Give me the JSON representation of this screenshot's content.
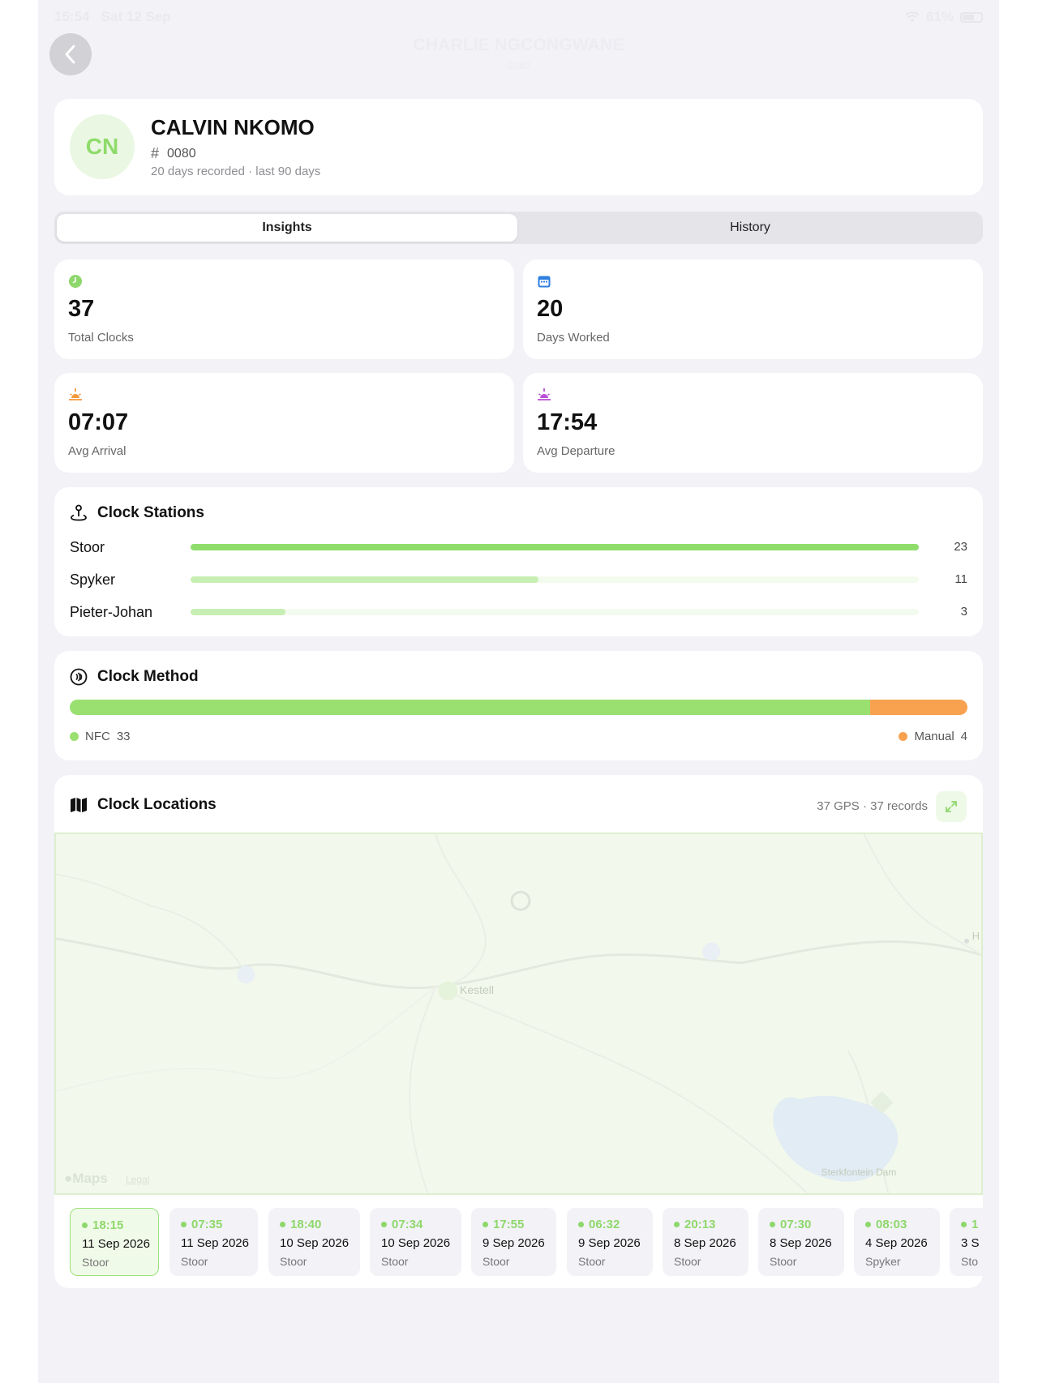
{
  "status_bar": {
    "time": "15:54",
    "date": "Sat 12 Sep",
    "battery": "61%"
  },
  "nav": {
    "title": "CHARLIE NGCONGWANE",
    "subtitle": "0080"
  },
  "profile": {
    "initials": "CN",
    "name": "CALVIN NKOMO",
    "id": "0080",
    "meta": "20 days recorded · last 90 days"
  },
  "tabs": [
    {
      "label": "Insights",
      "active": true
    },
    {
      "label": "History",
      "active": false
    }
  ],
  "stats": [
    {
      "value": "37",
      "label": "Total Clocks",
      "icon": "clock-icon",
      "color": "#8ed86b"
    },
    {
      "value": "20",
      "label": "Days Worked",
      "icon": "calendar-icon",
      "color": "#2f7fe0"
    },
    {
      "value": "07:07",
      "label": "Avg Arrival",
      "icon": "sunrise-icon",
      "color": "#f59a3c"
    },
    {
      "value": "17:54",
      "label": "Avg Departure",
      "icon": "sunset-icon",
      "color": "#b84fd6"
    }
  ],
  "stations": {
    "title": "Clock Stations",
    "items": [
      {
        "name": "Stoor",
        "count": "23",
        "fraction": 1.0,
        "color": "#8edd6a"
      },
      {
        "name": "Spyker",
        "count": "11",
        "fraction": 0.478,
        "color": "#c8efb3"
      },
      {
        "name": "Pieter-Johan",
        "count": "3",
        "fraction": 0.13,
        "color": "#c8efb3"
      }
    ]
  },
  "method": {
    "title": "Clock Method",
    "items": [
      {
        "label": "NFC",
        "count": "33",
        "value": 33,
        "color": "#99e070"
      },
      {
        "label": "Manual",
        "count": "4",
        "value": 4,
        "color": "#f8a24f"
      }
    ]
  },
  "locations": {
    "title": "Clock Locations",
    "summary": "37 GPS · 37 records",
    "map_labels": {
      "town": "Kestell",
      "dam": "Sterkfontein Dam",
      "maps_logo": "Maps",
      "legal": "Legal",
      "edge_label": "H"
    },
    "records": [
      {
        "time": "18:15",
        "date": "11 Sep 2026",
        "station": "Stoor",
        "selected": true
      },
      {
        "time": "07:35",
        "date": "11 Sep 2026",
        "station": "Stoor"
      },
      {
        "time": "18:40",
        "date": "10 Sep 2026",
        "station": "Stoor"
      },
      {
        "time": "07:34",
        "date": "10 Sep 2026",
        "station": "Stoor"
      },
      {
        "time": "17:55",
        "date": "9 Sep 2026",
        "station": "Stoor"
      },
      {
        "time": "06:32",
        "date": "9 Sep 2026",
        "station": "Stoor"
      },
      {
        "time": "20:13",
        "date": "8 Sep 2026",
        "station": "Stoor"
      },
      {
        "time": "07:30",
        "date": "8 Sep 2026",
        "station": "Stoor"
      },
      {
        "time": "08:03",
        "date": "4 Sep 2026",
        "station": "Spyker"
      },
      {
        "time": "1",
        "date": "3 S",
        "station": "Sto"
      }
    ]
  }
}
